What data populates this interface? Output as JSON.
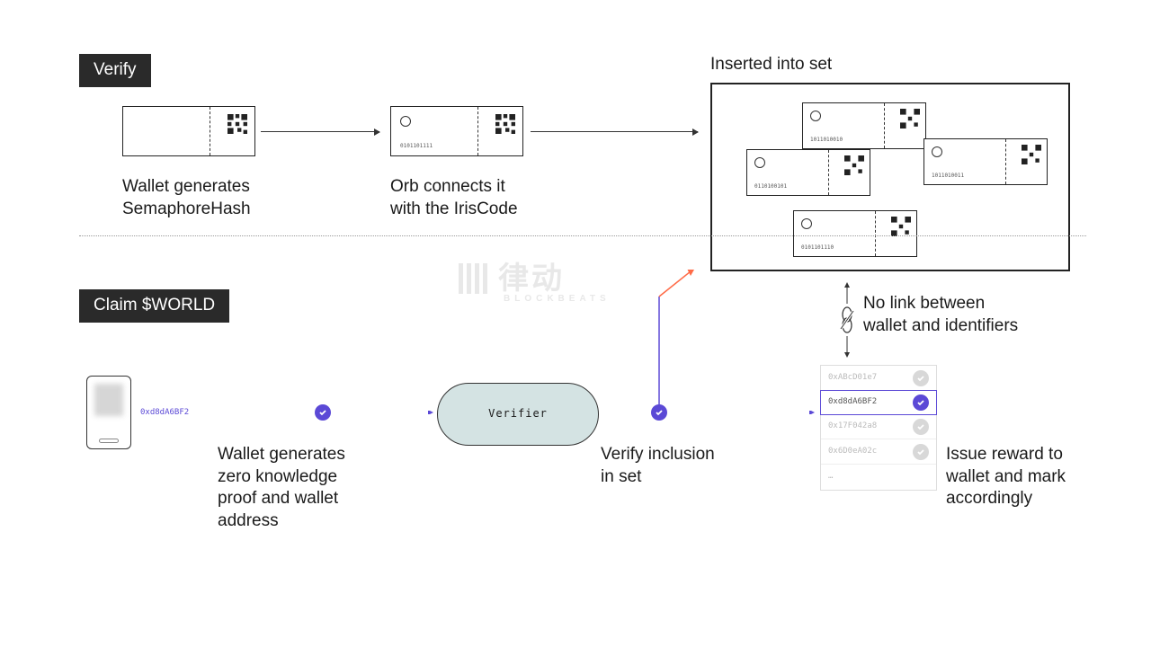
{
  "badges": {
    "verify": "Verify",
    "claim": "Claim $WORLD"
  },
  "verify": {
    "card1_label": "Wallet generates\nSemaphoreHash",
    "card2_label": "Orb connects it\nwith the IrisCode",
    "card2_code": "0101101111",
    "set_title": "Inserted into set",
    "set_codes": [
      "1011010010",
      "0110100101",
      "1011010011",
      "0101101110"
    ]
  },
  "claim": {
    "wallet_addr": "0xd8dA6BF2",
    "step1": "Wallet generates\nzero knowledge\nproof and wallet\naddress",
    "verifier": "Verifier",
    "step2": "Verify inclusion\nin set",
    "nolink": "No link between\nwallet and identifiers",
    "step3": "Issue reward to\nwallet and mark\naccordingly",
    "table": [
      "0xABcD01e7",
      "0xd8dA6BF2",
      "0x17F042a8",
      "0x6D0eA02c",
      "…"
    ]
  },
  "watermark": {
    "main": "律动",
    "sub": "BLOCKBEATS"
  }
}
